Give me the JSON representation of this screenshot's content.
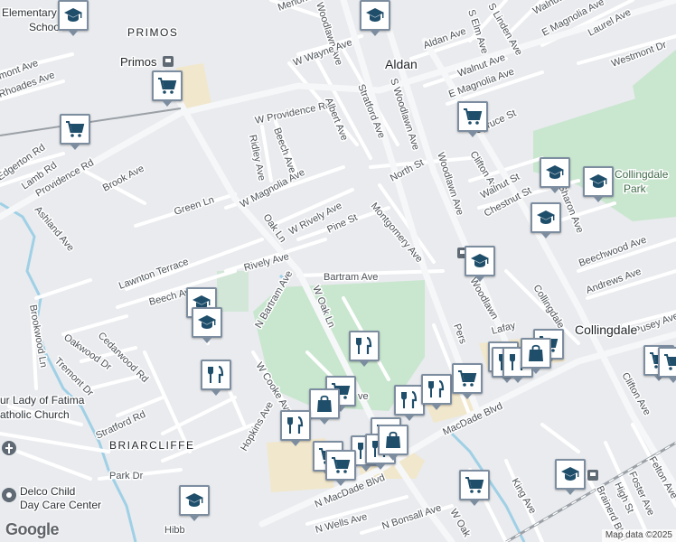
{
  "map": {
    "places": {
      "aldan": "Aldan",
      "collingdale": "Collingdale",
      "primos_upper": "PRIMOS",
      "primos": "Primos",
      "briarcliffe": "BRIARCLIFFE"
    },
    "pois": {
      "elementary_line1": "Elementary",
      "elementary_line2": "School",
      "collingdale_park_line1": "Collingdale",
      "collingdale_park_line2": "Park",
      "lady_fatima_line1": "ur Lady of Fatima",
      "lady_fatima_line2": "atholic Church",
      "delco_line1": "Delco Child",
      "delco_line2": "Day Care Center"
    },
    "streets": {
      "merion_ave": "Merion Ave",
      "woodlawn_ave_top": "Woodlawn Ave",
      "w_wayne_ave": "W Wayne Ave",
      "aldan_ave": "Aldan Ave",
      "s_elm_ave": "S Elm Ave",
      "s_linden_ave": "S Linden Ave",
      "walnut_ave_top": "Walnut Av",
      "e_magnolia_ave_top": "E Magnolia Ave",
      "laurel_ave": "Laurel Ave",
      "westmont_dr": "Westmont Dr",
      "walnut_ave": "Walnut Ave",
      "e_magnolia_ave": "E Magnolia Ave",
      "rhoades_ave": "Rhoades Ave",
      "mont_ave": "mont Ave",
      "w_providence_rd": "W Providence Rd",
      "albert_ave": "Albert Ave",
      "stratford_ave": "Stratford Ave",
      "s_woodlawn_ave": "S Woodlawn Ave",
      "spruce_st": "Spruce St",
      "ridley_ave": "Ridley Ave",
      "beech_ave_top": "Beech Ave",
      "providence_rd": "Providence Rd",
      "edgerton_rd": "Edgerton Rd",
      "lamb_rd": "Lamb Rd",
      "ashland_ave": "Ashland Ave",
      "brook_ave": "Brook Ave",
      "green_ln": "Green Ln",
      "w_magnolia_ave": "W Magnolia Ave",
      "north_st": "North St",
      "woodlawn_ave_mid": "Woodlawn Ave",
      "clifton_ave_top": "Clifton Ave",
      "walnut_st": "Walnut St",
      "chestnut_st": "Chestnut St",
      "sharon_ave": "Sharon Ave",
      "oak_ln": "Oak Ln",
      "w_rively_ave": "W Rively Ave",
      "pine_st": "Pine St",
      "montgomery_ave": "Montgomery Ave",
      "lawnton_terrace": "Lawnton Terrace",
      "rively_ave": "Rively Ave",
      "bartram_ave": "Bartram Ave",
      "woodlawn_ave_low": "Woodlawn",
      "beechwood_ave": "Beechwood Ave",
      "andrews_ave": "Andrews Ave",
      "collingdale_st": "Collingdale",
      "beech_ave": "Beech Ave",
      "n_bartram_ave": "N Bartram Ave",
      "w_oak_ln": "W Oak Ln",
      "brookwood_ln": "Brookwood Ln",
      "oakwood_dr": "Oakwood Dr",
      "cedarwood_rd": "Cedarwood Rd",
      "tremont_dr": "Tremont Dr",
      "w_cooke_ave": "W Cooke Ave",
      "hopkins_ave": "Hopkins Ave",
      "stratford_rd": "Stratford Rd",
      "lafay": "Lafay",
      "pers": "Pers",
      "pusey_ave": "Pusey Ave",
      "clifton_ave_low": "Clifton Ave",
      "macdade_blvd": "MacDade Blvd",
      "park_dr": "Park Dr",
      "n_macdade_blvd": "N MacDade Blvd",
      "n_wells_ave": "N Wells Ave",
      "n_bonsall_ave": "N Bonsall Ave",
      "w_oak_low": "W Oak",
      "king_ave": "King Ave",
      "felton_ave": "Felton Ave",
      "foster_ave": "Foster Ave",
      "high_st": "High St",
      "brainerd_blvd": "Brainerd Blvd",
      "ave_suffix": "ve",
      "hibb": "Hibb"
    },
    "markers": [
      {
        "icon": "school-icon"
      },
      {
        "icon": "school-icon"
      },
      {
        "icon": "shopping-cart-icon"
      },
      {
        "icon": "shopping-cart-icon"
      },
      {
        "icon": "shopping-cart-icon"
      },
      {
        "icon": "school-icon"
      },
      {
        "icon": "school-icon"
      },
      {
        "icon": "school-icon"
      },
      {
        "icon": "school-icon"
      },
      {
        "icon": "school-icon"
      },
      {
        "icon": "school-icon"
      },
      {
        "icon": "school-icon"
      },
      {
        "icon": "restaurant-icon"
      },
      {
        "icon": "restaurant-icon"
      },
      {
        "icon": "shopping-cart-icon"
      },
      {
        "icon": "shopping-bag-icon"
      },
      {
        "icon": "restaurant-icon"
      },
      {
        "icon": "restaurant-icon"
      },
      {
        "icon": "restaurant-icon"
      },
      {
        "icon": "shopping-cart-icon"
      },
      {
        "icon": "shopping-cart-icon"
      },
      {
        "icon": "restaurant-icon"
      },
      {
        "icon": "restaurant-icon"
      },
      {
        "icon": "shopping-cart-icon"
      },
      {
        "icon": "shopping-bag-icon"
      },
      {
        "icon": "shopping-cart-icon"
      },
      {
        "icon": "shopping-cart-icon"
      },
      {
        "icon": "shopping-cart-icon"
      },
      {
        "icon": "restaurant-icon"
      },
      {
        "icon": "restaurant-icon"
      },
      {
        "icon": "shopping-bag-icon"
      },
      {
        "icon": "shopping-cart-icon"
      },
      {
        "icon": "shopping-cart-icon"
      },
      {
        "icon": "shopping-cart-icon"
      },
      {
        "icon": "school-icon"
      }
    ],
    "colors": {
      "background": "#e9ebee",
      "road": "#ffffff",
      "road_major": "#f6f7f8",
      "park": "#c9e6cf",
      "commercial": "#f1e7cc",
      "water": "#9fd0e6",
      "rail": "#9aa0a6",
      "marker_border": "#7d8da0",
      "marker_icon": "#1f4e6b"
    }
  },
  "branding": {
    "logo": "Google",
    "attribution": "Map data ©2025"
  }
}
